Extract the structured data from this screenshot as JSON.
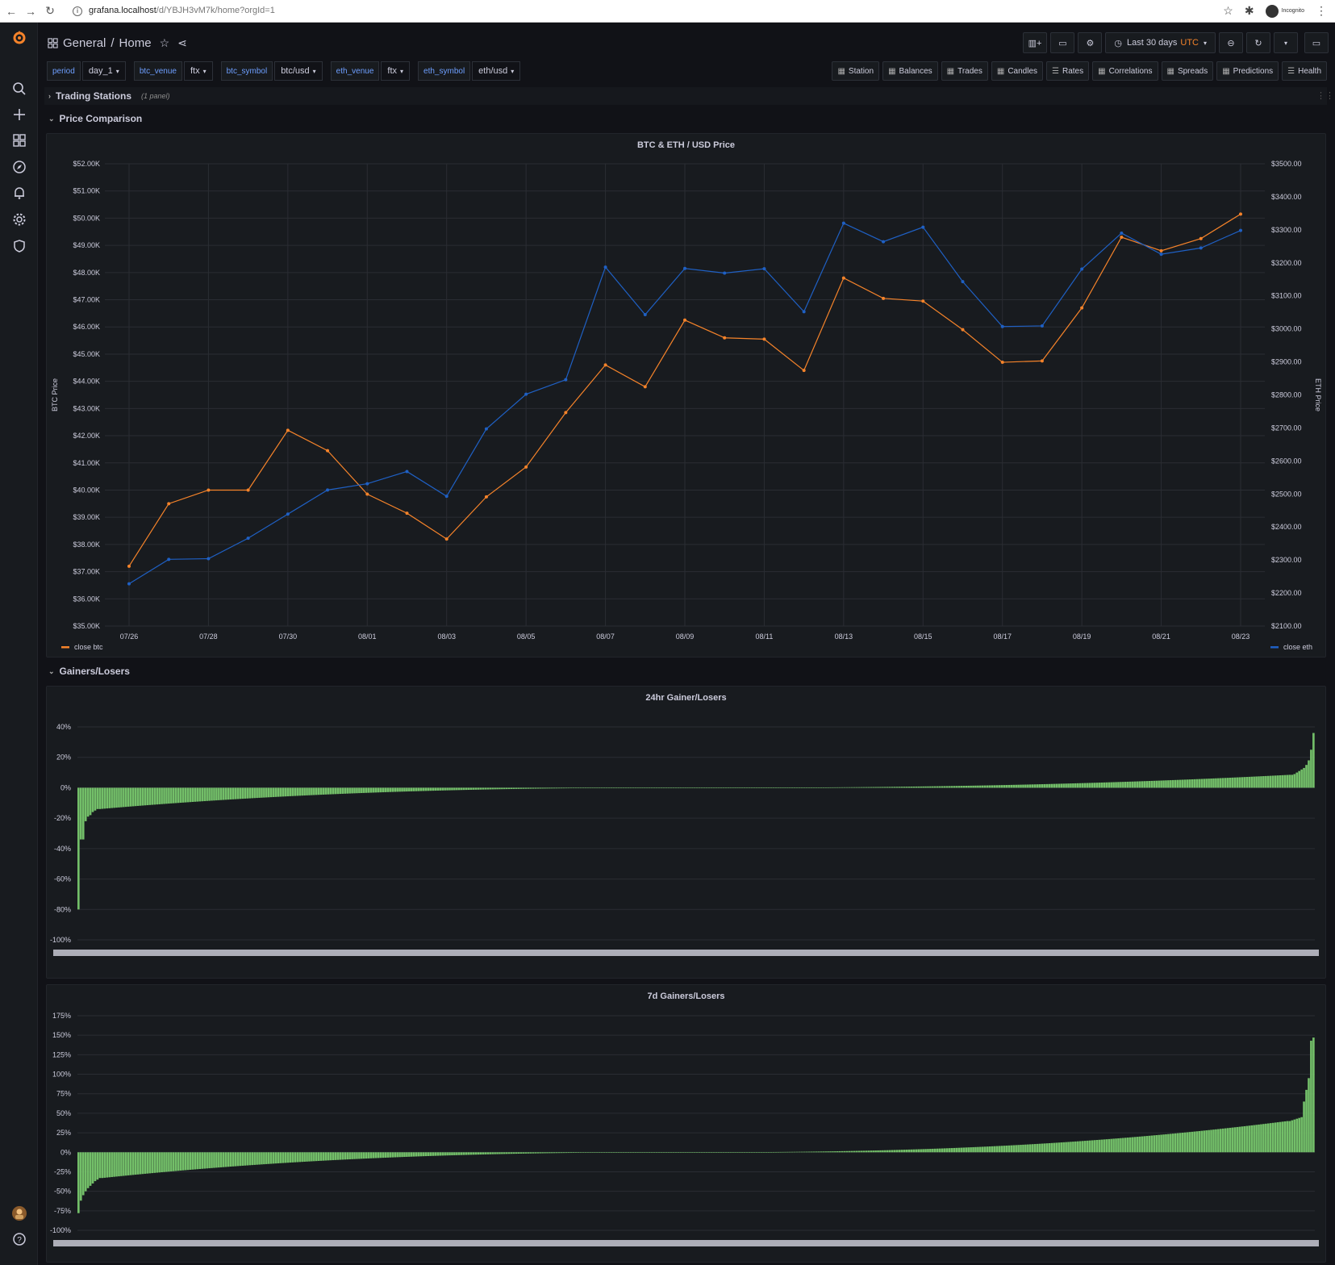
{
  "browser": {
    "url_host": "grafana.localhost",
    "url_path": "/d/YBJH3vM7k/home?orgId=1",
    "incognito_label": "Incognito"
  },
  "header": {
    "folder": "General",
    "separator": "/",
    "title": "Home",
    "time_range": "Last 30 days",
    "timezone": "UTC"
  },
  "variables": [
    {
      "label": "period",
      "value": "day_1"
    },
    {
      "label": "btc_venue",
      "value": "ftx"
    },
    {
      "label": "btc_symbol",
      "value": "btc/usd"
    },
    {
      "label": "eth_venue",
      "value": "ftx"
    },
    {
      "label": "eth_symbol",
      "value": "eth/usd"
    }
  ],
  "links": [
    "Station",
    "Balances",
    "Trades",
    "Candles",
    "Rates",
    "Correlations",
    "Spreads",
    "Predictions",
    "Health"
  ],
  "rows": {
    "trading": {
      "title": "Trading Stations",
      "sub": "(1 panel)"
    },
    "price": {
      "title": "Price Comparison"
    },
    "gainers": {
      "title": "Gainers/Losers"
    }
  },
  "colors": {
    "btc": "#f5832a",
    "eth": "#1f60c4",
    "bars": "#73bf69"
  },
  "chart_data": [
    {
      "type": "line",
      "title": "BTC & ETH / USD Price",
      "ylabel": "BTC Price",
      "ylabel_right": "ETH Price",
      "x": [
        "07/26",
        "07/27",
        "07/28",
        "07/29",
        "07/30",
        "07/31",
        "08/01",
        "08/02",
        "08/03",
        "08/04",
        "08/05",
        "08/06",
        "08/07",
        "08/08",
        "08/09",
        "08/10",
        "08/11",
        "08/12",
        "08/13",
        "08/14",
        "08/15",
        "08/16",
        "08/17",
        "08/18",
        "08/19",
        "08/20",
        "08/21",
        "08/22",
        "08/23"
      ],
      "x_tick_labels": [
        "07/26",
        "07/28",
        "07/30",
        "08/01",
        "08/03",
        "08/05",
        "08/07",
        "08/09",
        "08/11",
        "08/13",
        "08/15",
        "08/17",
        "08/19",
        "08/21",
        "08/23"
      ],
      "ylim": [
        35000,
        52000
      ],
      "ylim_right": [
        2100,
        3500
      ],
      "y_ticks": [
        "$35.00K",
        "$36.00K",
        "$37.00K",
        "$38.00K",
        "$39.00K",
        "$40.00K",
        "$41.00K",
        "$42.00K",
        "$43.00K",
        "$44.00K",
        "$45.00K",
        "$46.00K",
        "$47.00K",
        "$48.00K",
        "$49.00K",
        "$50.00K",
        "$51.00K",
        "$52.00K"
      ],
      "y_ticks_right": [
        "$2100.00",
        "$2200.00",
        "$2300.00",
        "$2400.00",
        "$2500.00",
        "$2600.00",
        "$2700.00",
        "$2800.00",
        "$2900.00",
        "$3000.00",
        "$3100.00",
        "$3200.00",
        "$3300.00",
        "$3400.00",
        "$3500.00"
      ],
      "series": [
        {
          "name": "close btc",
          "axis": "left",
          "values": [
            37200,
            39500,
            40000,
            40000,
            42200,
            41450,
            39850,
            39150,
            38200,
            39750,
            40850,
            42850,
            44600,
            43800,
            46250,
            45600,
            45550,
            44400,
            47800,
            47050,
            46950,
            45900,
            44700,
            44750,
            46700,
            49300,
            48800,
            49250,
            50150
          ]
        },
        {
          "name": "close eth",
          "axis": "right",
          "values": [
            2228,
            2302,
            2304,
            2366,
            2439,
            2512,
            2531,
            2568,
            2493,
            2697,
            2802,
            2846,
            3187,
            3043,
            3183,
            3169,
            3182,
            3052,
            3320,
            3264,
            3308,
            3143,
            3007,
            3009,
            3181,
            3290,
            3226,
            3245,
            3298
          ]
        }
      ]
    },
    {
      "type": "bar",
      "title": "24hr Gainer/Losers",
      "ylim": [
        -100,
        40
      ],
      "y_ticks": [
        "40%",
        "20%",
        "0%",
        "-20%",
        "-40%",
        "-60%",
        "-80%",
        "-100%"
      ],
      "distribution": {
        "count": 520,
        "min": -80,
        "max": 36,
        "low_tail": [
          -80,
          -34,
          -34,
          -22,
          -19,
          -18,
          -16,
          -15,
          -14
        ],
        "high_tail": [
          36,
          25,
          18,
          15,
          13,
          12,
          11,
          10,
          9,
          8.5
        ]
      }
    },
    {
      "type": "bar",
      "title": "7d Gainers/Losers",
      "ylim": [
        -100,
        175
      ],
      "y_ticks": [
        "175%",
        "150%",
        "125%",
        "100%",
        "75%",
        "50%",
        "25%",
        "0%",
        "-25%",
        "-50%",
        "-75%",
        "-100%"
      ],
      "distribution": {
        "count": 520,
        "min": -78,
        "max": 147,
        "low_tail": [
          -78,
          -62,
          -55,
          -50,
          -46,
          -43,
          -40,
          -37,
          -35,
          -33
        ],
        "high_tail": [
          147,
          143,
          95,
          80,
          65,
          45,
          44,
          43,
          42,
          41,
          40
        ]
      }
    }
  ]
}
